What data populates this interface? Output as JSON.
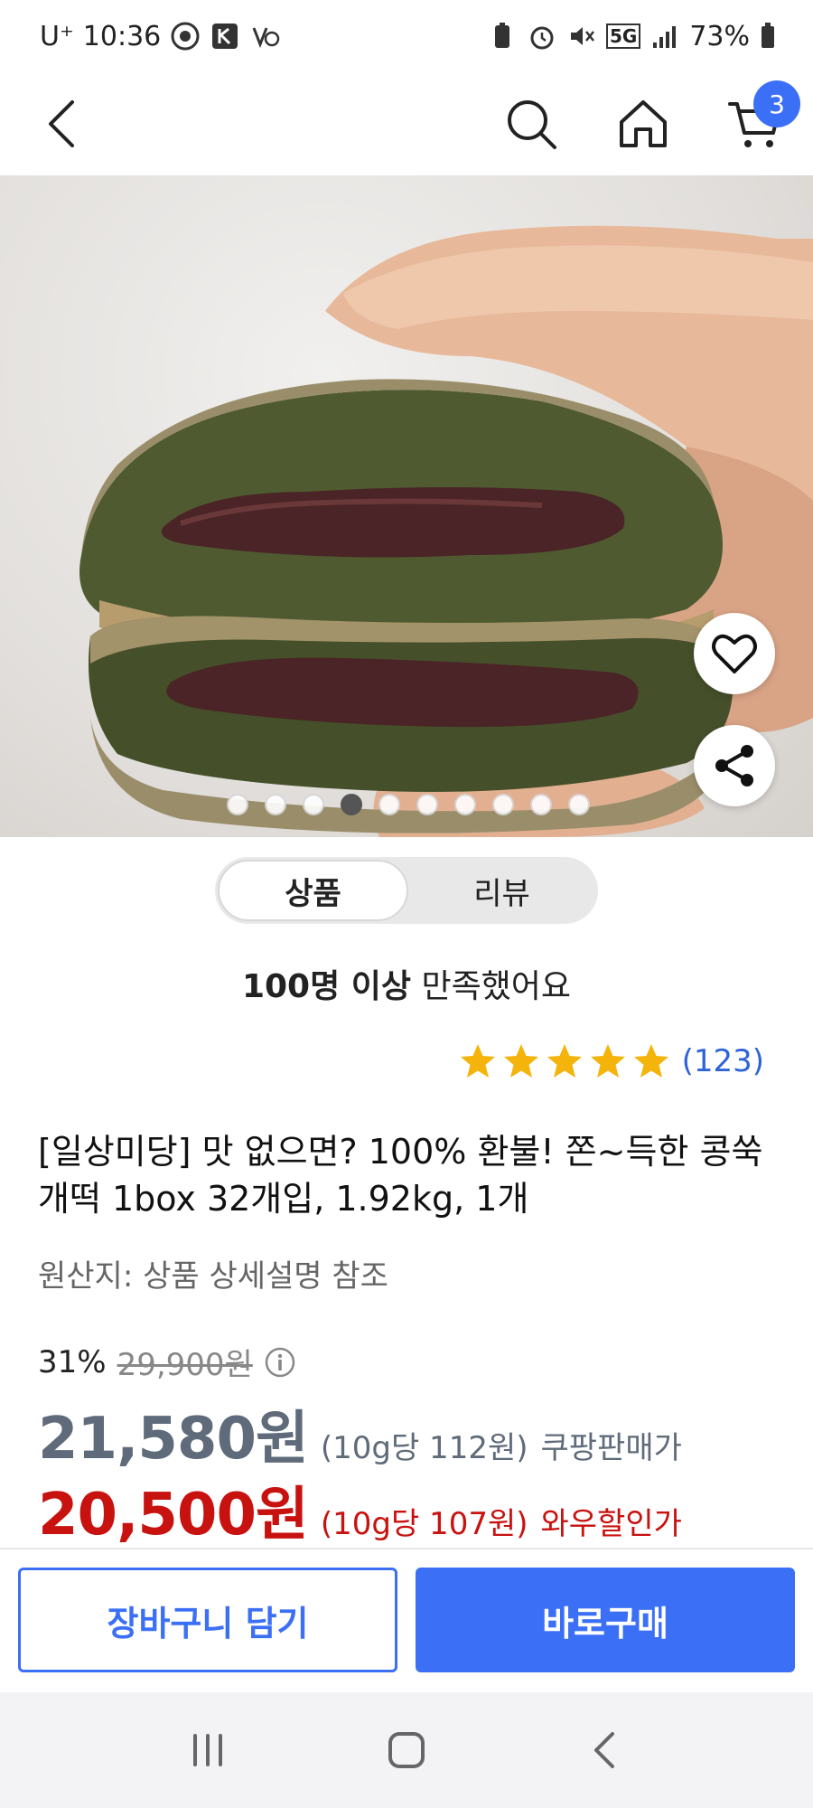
{
  "status_bar": {
    "carrier": "U⁺",
    "time": "10:36",
    "network": "5G",
    "battery": "73%"
  },
  "header": {
    "cart_count": "3"
  },
  "gallery": {
    "total_images": 10,
    "active_index": 3
  },
  "tabs": [
    {
      "label": "상품",
      "active": true
    },
    {
      "label": "리뷰",
      "active": false
    }
  ],
  "satisfaction": {
    "bold": "100명 이상",
    "rest": " 만족했어요"
  },
  "rating": {
    "stars": 5,
    "count": "(123)"
  },
  "product": {
    "title": "[일상미당] 맛 없으면? 100% 환불! 쫀~득한 콩쑥개떡 1box 32개입, 1.92kg, 1개",
    "origin": "원산지: 상품 상세설명 참조"
  },
  "pricing": {
    "discount": "31%",
    "original_price": "29,900원",
    "coupang_price": "21,580원",
    "coupang_unit": "(10g당 112원)",
    "coupang_label": "쿠팡판매가",
    "wow_price": "20,500원",
    "wow_unit": "(10g당 107원)",
    "wow_label": "와우할인가"
  },
  "actions": {
    "add_to_cart": "장바구니 담기",
    "buy_now": "바로구매"
  },
  "colors": {
    "accent_blue": "#3b6ff5",
    "wow_red": "#c8120f",
    "star_yellow": "#f5b40b"
  }
}
